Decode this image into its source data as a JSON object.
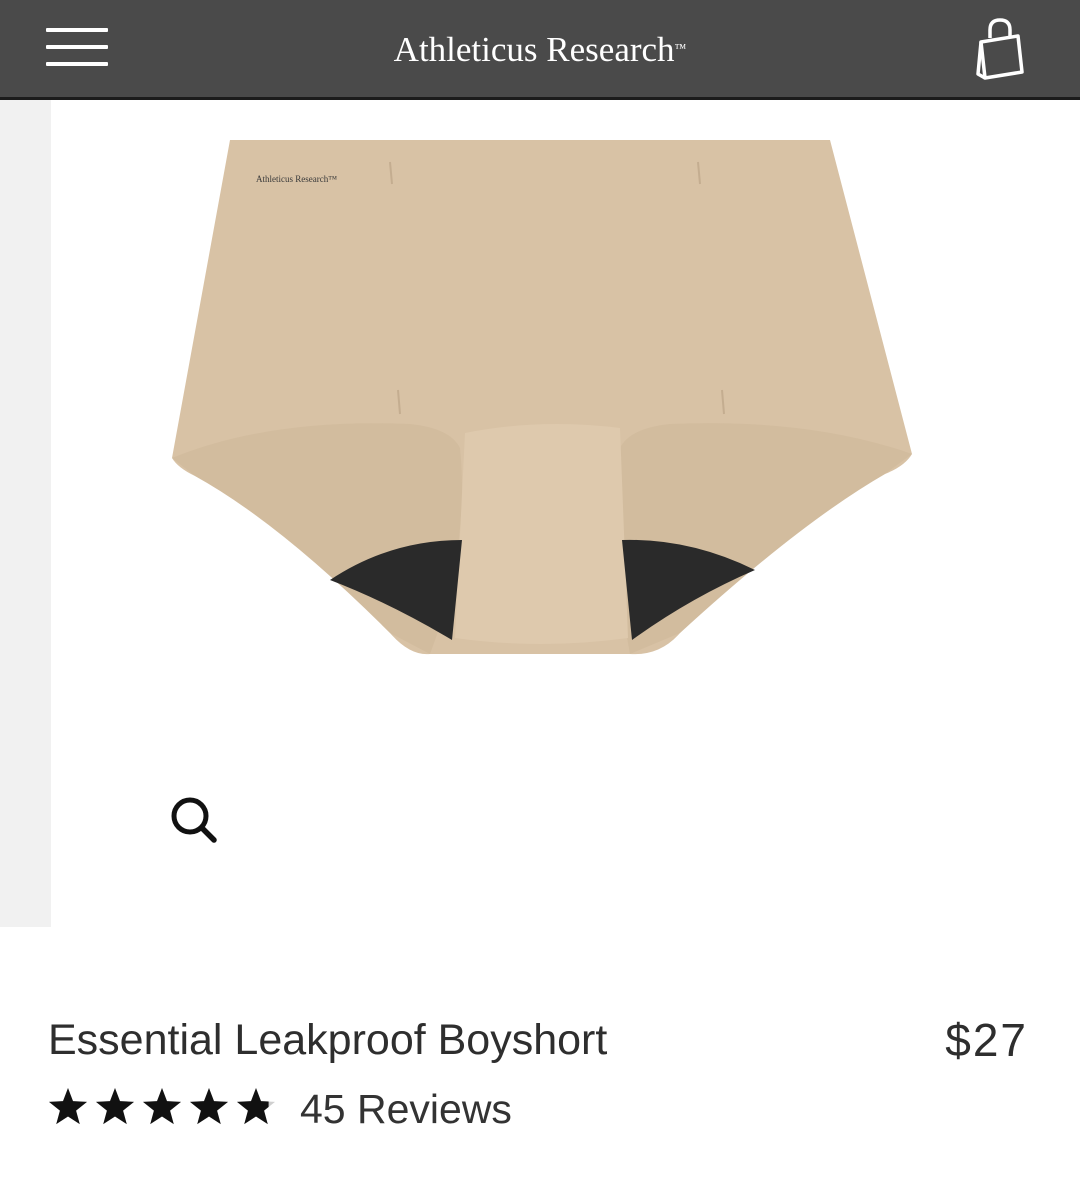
{
  "header": {
    "menu_icon": "hamburger-menu-icon",
    "brand_name": "Athleticus Research",
    "brand_mark": "™",
    "cart_icon": "shopping-bag-icon",
    "background_color": "#4a4a4a"
  },
  "gallery": {
    "image_label": "Athleticus Research™",
    "zoom_icon": "magnifier-icon"
  },
  "product": {
    "title": "Essential Leakproof Boyshort",
    "price": "$27",
    "rating": 4.8,
    "rating_max": 5,
    "reviews": "45 Reviews",
    "fabric_color": "#d8c2a5"
  }
}
